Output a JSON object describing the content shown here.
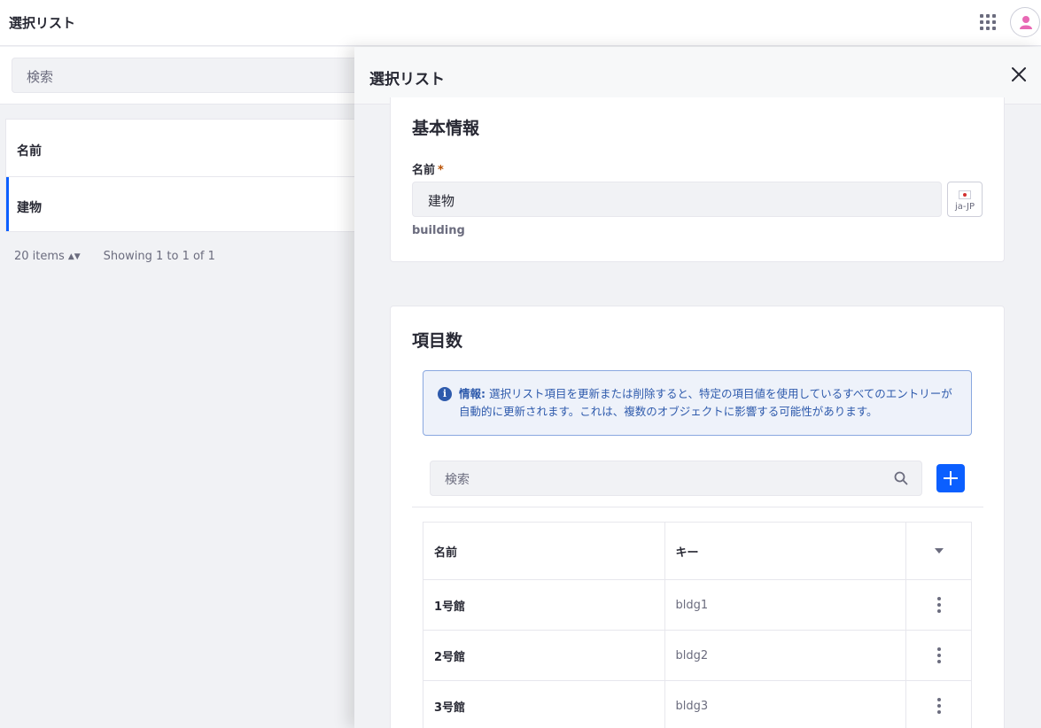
{
  "app": {
    "title": "選択リスト"
  },
  "left": {
    "search_placeholder": "検索",
    "table_header": "名前",
    "rows": [
      {
        "name": "建物",
        "selected": true
      }
    ],
    "pagination": {
      "page_size": "20 items",
      "summary": "Showing 1 to 1 of 1"
    }
  },
  "panel": {
    "title": "選択リスト",
    "basic_info": {
      "title": "基本情報",
      "name_label": "名前",
      "required_mark": "*",
      "name_value": "建物",
      "locale": "ja-JP",
      "key": "building"
    },
    "items": {
      "title": "項目数",
      "info_label": "情報:",
      "info_text": "選択リスト項目を更新または削除すると、特定の項目値を使用しているすべてのエントリーが自動的に更新されます。これは、複数のオブジェクトに影響する可能性があります。",
      "search_placeholder": "検索",
      "columns": {
        "name": "名前",
        "key": "キー"
      },
      "rows": [
        {
          "name": "1号館",
          "key": "bldg1"
        },
        {
          "name": "2号館",
          "key": "bldg2"
        },
        {
          "name": "3号館",
          "key": "bldg3"
        }
      ]
    }
  },
  "colors": {
    "accent": "#0b5fff",
    "info": "#2e5aac",
    "avatar": "#e868b4"
  },
  "icons": {
    "apps": "apps-grid-icon",
    "user": "user-icon",
    "close": "close-icon",
    "search": "search-icon",
    "add": "plus-icon",
    "info": "info-icon",
    "menu": "kebab-icon"
  }
}
